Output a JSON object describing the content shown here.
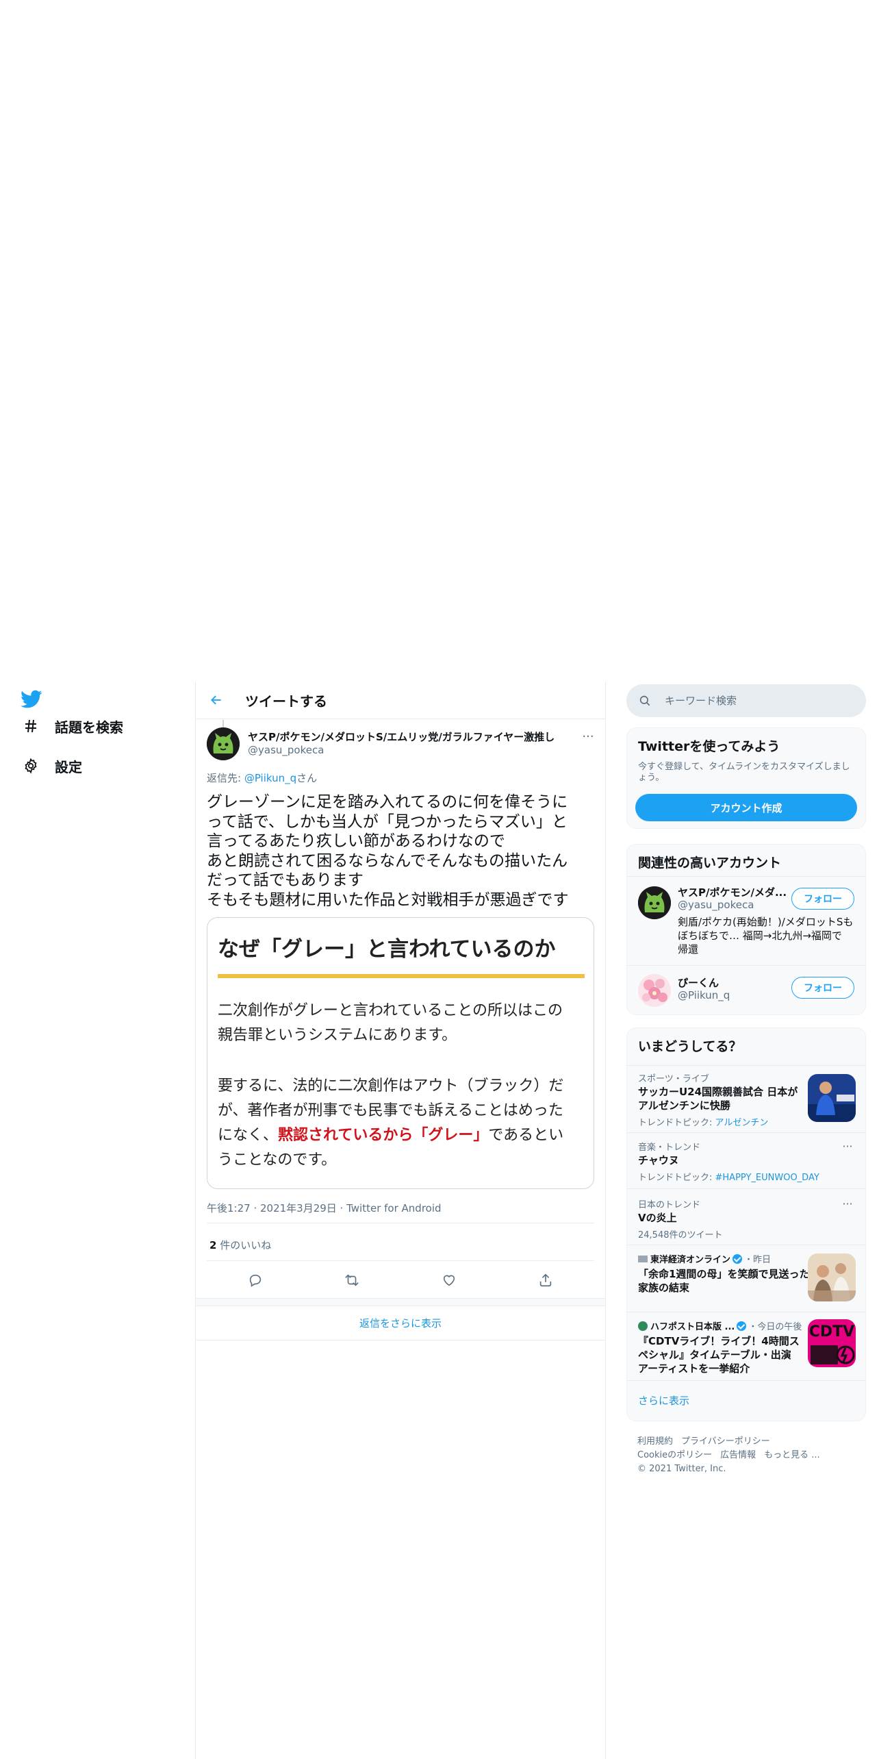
{
  "nav": {
    "items": [
      {
        "label": "話題を検索",
        "icon": "hashtag-icon"
      },
      {
        "label": "設定",
        "icon": "gear-icon"
      }
    ]
  },
  "header": {
    "title": "ツイートする"
  },
  "tweet": {
    "author_name": "ヤスP/ポケモン/メダロットS/エムリッ党/ガラルファイヤー激推し",
    "author_handle": "@yasu_pokeca",
    "reply_prefix": "返信先: ",
    "reply_to": "@Piikun_q",
    "reply_suffix": "さん",
    "text_lines": [
      "グレーゾーンに足を踏み入れてるのに何を偉そうに",
      "って話で、しかも当人が「見つかったらマズい」と",
      "言ってるあたり疚しい節があるわけなので",
      "あと朗読されて困るならなんでそんなもの描いたん",
      "だって話でもあります",
      "そもそも題材に用いた作品と対戦相手が悪過ぎです"
    ],
    "card": {
      "title": "なぜ「グレー」と言われているのか",
      "para1_lines": [
        "二次創作がグレーと言われていることの所以はこの",
        "親告罪というシステムにあります。"
      ],
      "para2_line1": "要するに、法的に二次創作はアウト（ブラック）だ",
      "para2_line2": "が、著作者が刑事でも民事でも訴えることはめった",
      "para2_line3_pre": "になく、",
      "para2_line3_red": "黙認されているから「グレー」",
      "para2_line3_post": "であるとい",
      "para2_line4": "うことなのです。",
      "accent_color": "#f0c040",
      "red_color": "#d0121b"
    },
    "meta": "午後1:27 · 2021年3月29日 · Twitter for Android",
    "likes_count": "2",
    "likes_label": " 件のいいね",
    "show_more_replies": "返信をさらに表示"
  },
  "search": {
    "placeholder": "キーワード検索"
  },
  "signup": {
    "title": "Twitterを使ってみよう",
    "subtitle": "今すぐ登録して、タイムラインをカスタマイズしましょう。",
    "button": "アカウント作成"
  },
  "related": {
    "title": "関連性の高いアカウント",
    "accounts": [
      {
        "name": "ヤスP/ポケモン/メダ...",
        "handle": "@yasu_pokeca",
        "bio_lines": [
          "剣盾/ポケカ(再始動！)/メダロットSも",
          "ぼちぼちで… 福岡→北九州→福岡で",
          "帰還"
        ],
        "follow": "フォロー"
      },
      {
        "name": "ぴーくん",
        "handle": "@Piikun_q",
        "follow": "フォロー"
      }
    ]
  },
  "trends": {
    "title": "いまどうしてる？",
    "items": [
      {
        "category": "スポーツ・ライブ",
        "title_lines": [
          "サッカーU24国際親善試合 日本が",
          "アルゼンチンに快勝"
        ],
        "sub_prefix": "トレンドトピック: ",
        "sub_link": "アルゼンチン"
      },
      {
        "category": "音楽・トレンド",
        "title_lines": [
          "チャウヌ"
        ],
        "sub_prefix": "トレンドトピック: ",
        "sub_link": "#HAPPY_EUNWOO_DAY"
      },
      {
        "category": "日本のトレンド",
        "title_lines": [
          "Vの炎上"
        ],
        "sub_prefix": "24,548件のツイート",
        "sub_link": ""
      },
      {
        "source": "東洋経済オンライン",
        "time": "・昨日",
        "title_lines": [
          "「余命1週間の母」を笑顔で見送った",
          "家族の結束"
        ]
      },
      {
        "source": "ハフポスト日本版 ...",
        "time": "・今日の午後",
        "title_lines": [
          "『CDTVライブ！ライブ！4時間ス",
          "ペシャル』タイムテーブル・出演",
          "アーティストを一挙紹介"
        ],
        "thumb_text": "CDTV"
      }
    ],
    "show_more": "さらに表示"
  },
  "footer": {
    "links_row1": [
      "利用規約",
      "プライバシーポリシー"
    ],
    "links_row2": [
      "Cookieのポリシー",
      "広告情報",
      "もっと見る ..."
    ],
    "copyright": "© 2021 Twitter, Inc."
  },
  "colors": {
    "accent": "#1da1f2",
    "link": "#1b95e0",
    "muted": "#5b7083"
  }
}
